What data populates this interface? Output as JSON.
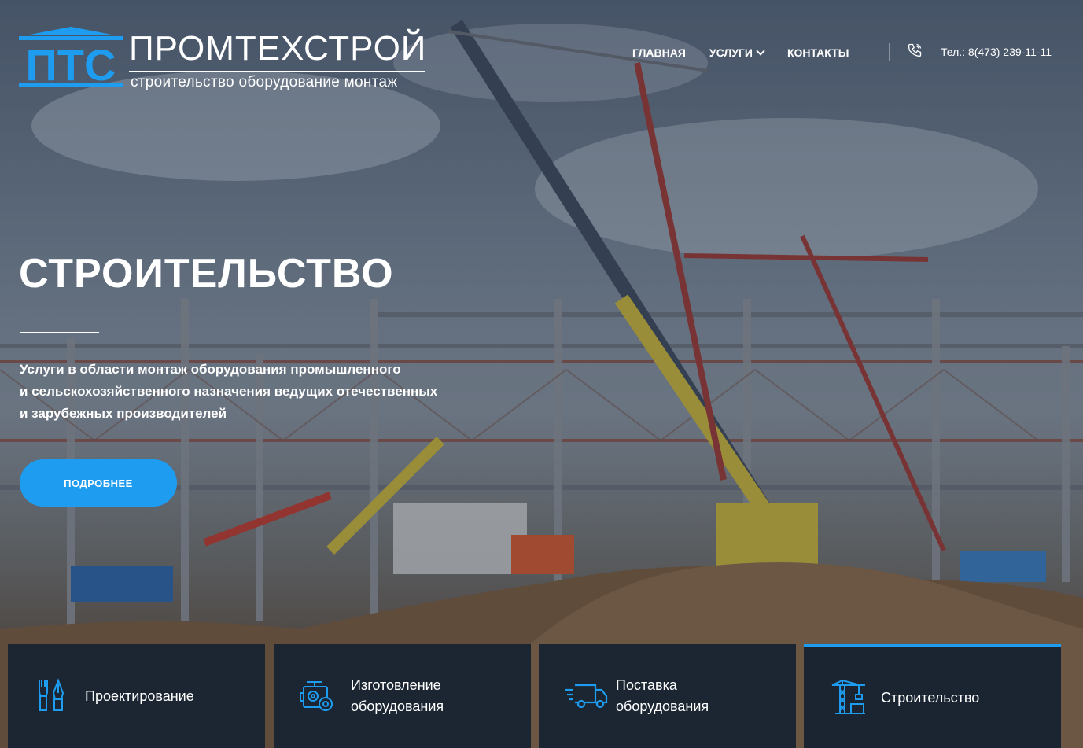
{
  "brand": {
    "logo_letters": "ПТС",
    "name": "ПРОМТЕХСТРОЙ",
    "tagline": "строительство оборудование монтаж"
  },
  "nav": {
    "items": [
      {
        "label": "ГЛАВНАЯ",
        "has_dropdown": false
      },
      {
        "label": "УСЛУГИ",
        "has_dropdown": true
      },
      {
        "label": "КОНТАКТЫ",
        "has_dropdown": false
      }
    ],
    "phone": "Тел.: 8(473) 239-11-11",
    "phone_icon": "phone-icon"
  },
  "hero": {
    "title": "СТРОИТЕЛЬСТВО",
    "description_lines": [
      "Услуги в области монтаж оборудования промышленного",
      "и сельскохозяйственного назначения ведущих отечественных",
      "и зарубежных производителей"
    ],
    "cta_label": "ПОДРОБНЕЕ"
  },
  "services": [
    {
      "label_lines": [
        "Проектирование"
      ],
      "icon": "design-tools-icon",
      "active": false
    },
    {
      "label_lines": [
        "Изготовление",
        "оборудования"
      ],
      "icon": "manufacturing-icon",
      "active": false
    },
    {
      "label_lines": [
        "Поставка",
        "оборудования"
      ],
      "icon": "delivery-truck-icon",
      "active": false
    },
    {
      "label_lines": [
        "Строительство"
      ],
      "icon": "crane-icon",
      "active": true
    }
  ],
  "colors": {
    "accent": "#1e9cf0",
    "card_bg": "#1c2633",
    "logo_blue": "#1e9cf0"
  }
}
